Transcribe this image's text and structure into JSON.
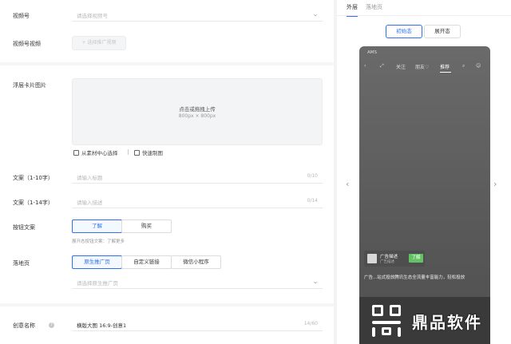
{
  "form": {
    "video_account": {
      "label": "视频号",
      "placeholder": "请选择视频号"
    },
    "video_account_video": {
      "label": "视频号视频",
      "button": "+ 选择推广视频"
    },
    "floating_card_image": {
      "label": "浮层卡片图片",
      "upload_text": "点击或拖拽上传",
      "upload_size": "800px × 800px",
      "from_library": "从素材中心选择",
      "quick_make": "快速制图"
    },
    "copy_1": {
      "label": "文案（1-10字）",
      "placeholder": "请输入标题",
      "counter": "0/10"
    },
    "copy_2": {
      "label": "文案（1-14字）",
      "placeholder": "请输入描述",
      "counter": "0/14"
    },
    "button_copy": {
      "label": "按钮文案",
      "options": [
        "了解",
        "购买"
      ],
      "selected": "了解",
      "hint": "展开态按钮文案：了解更多"
    },
    "landing_page": {
      "label": "落地页",
      "options": [
        "原生推广页",
        "自定义链接",
        "微信小程序"
      ],
      "selected": "原生推广页",
      "placeholder": "请选择原生推广页"
    },
    "creative_name": {
      "label": "创意名称",
      "value": "横版大图 16:9-创意1",
      "counter": "14/60"
    }
  },
  "preview": {
    "tabs": [
      "外层",
      "落地页"
    ],
    "active_tab": "外层",
    "states": [
      "初始态",
      "展开态"
    ],
    "active_state": "初始态",
    "phone": {
      "status": "AMS",
      "nav_items": [
        "关注",
        "朋友♡",
        "推荐"
      ],
      "active_nav": "推荐",
      "ad_title": "广告描述",
      "ad_sub": "广告描述",
      "ad_button": "了解",
      "desc": "广告...站式投放腾讯生态全流量丰富能力，轻松投放"
    }
  },
  "watermark": {
    "text": "鼎品软件"
  },
  "colors": {
    "accent": "#2f6ff0",
    "ad_button": "#63c364"
  }
}
